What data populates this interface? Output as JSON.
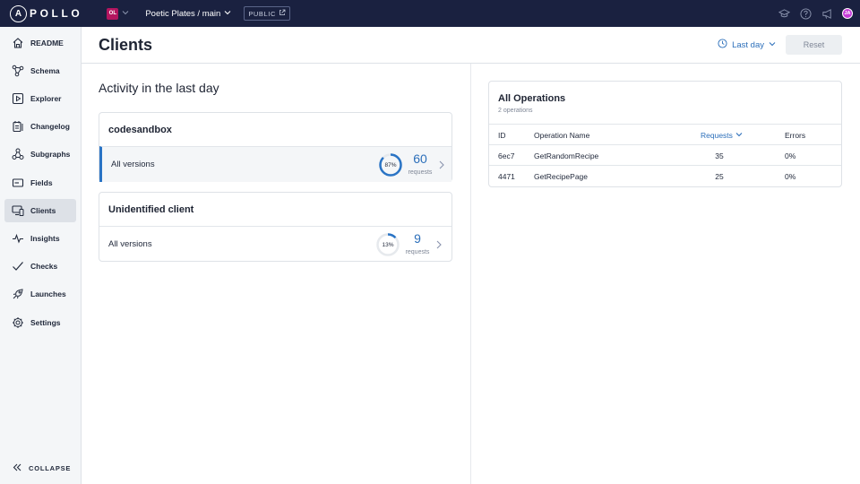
{
  "topbar": {
    "logo_letter": "A",
    "logo_rest": "POLLO",
    "org_initials": "OL",
    "graph_name": "Poetic Plates / main",
    "public_label": "PUBLIC",
    "avatar_initials": "JA"
  },
  "sidebar": {
    "items": [
      {
        "label": "README",
        "icon": "readme-icon"
      },
      {
        "label": "Schema",
        "icon": "schema-icon"
      },
      {
        "label": "Explorer",
        "icon": "explorer-icon"
      },
      {
        "label": "Changelog",
        "icon": "changelog-icon"
      },
      {
        "label": "Subgraphs",
        "icon": "subgraphs-icon"
      },
      {
        "label": "Fields",
        "icon": "fields-icon"
      },
      {
        "label": "Clients",
        "icon": "clients-icon",
        "active": true
      },
      {
        "label": "Insights",
        "icon": "insights-icon"
      },
      {
        "label": "Checks",
        "icon": "checks-icon"
      },
      {
        "label": "Launches",
        "icon": "launches-icon"
      },
      {
        "label": "Settings",
        "icon": "settings-icon"
      }
    ],
    "collapse_label": "COLLAPSE"
  },
  "header": {
    "title": "Clients",
    "range_label": "Last day",
    "reset_label": "Reset"
  },
  "activity": {
    "title": "Activity in the last day",
    "clients": [
      {
        "name": "codesandbox",
        "version_label": "All versions",
        "percent": 87,
        "percent_label": "87%",
        "requests": "60",
        "requests_label": "requests",
        "selected": true
      },
      {
        "name": "Unidentified client",
        "version_label": "All versions",
        "percent": 13,
        "percent_label": "13%",
        "requests": "9",
        "requests_label": "requests",
        "selected": false
      }
    ]
  },
  "operations": {
    "title": "All Operations",
    "subtitle": "2 operations",
    "columns": {
      "id": "ID",
      "name": "Operation Name",
      "requests": "Requests",
      "errors": "Errors"
    },
    "rows": [
      {
        "id": "6ec7",
        "name": "GetRandomRecipe",
        "requests": "35",
        "errors": "0%"
      },
      {
        "id": "4471",
        "name": "GetRecipePage",
        "requests": "25",
        "errors": "0%"
      }
    ]
  },
  "colors": {
    "topbar_bg": "#1a2140",
    "accent": "#2c6fba",
    "donut_track": "#e6e9ed",
    "donut_fill": "#2a74c5",
    "org_badge": "#b3155f",
    "avatar": "#c63ad8"
  }
}
